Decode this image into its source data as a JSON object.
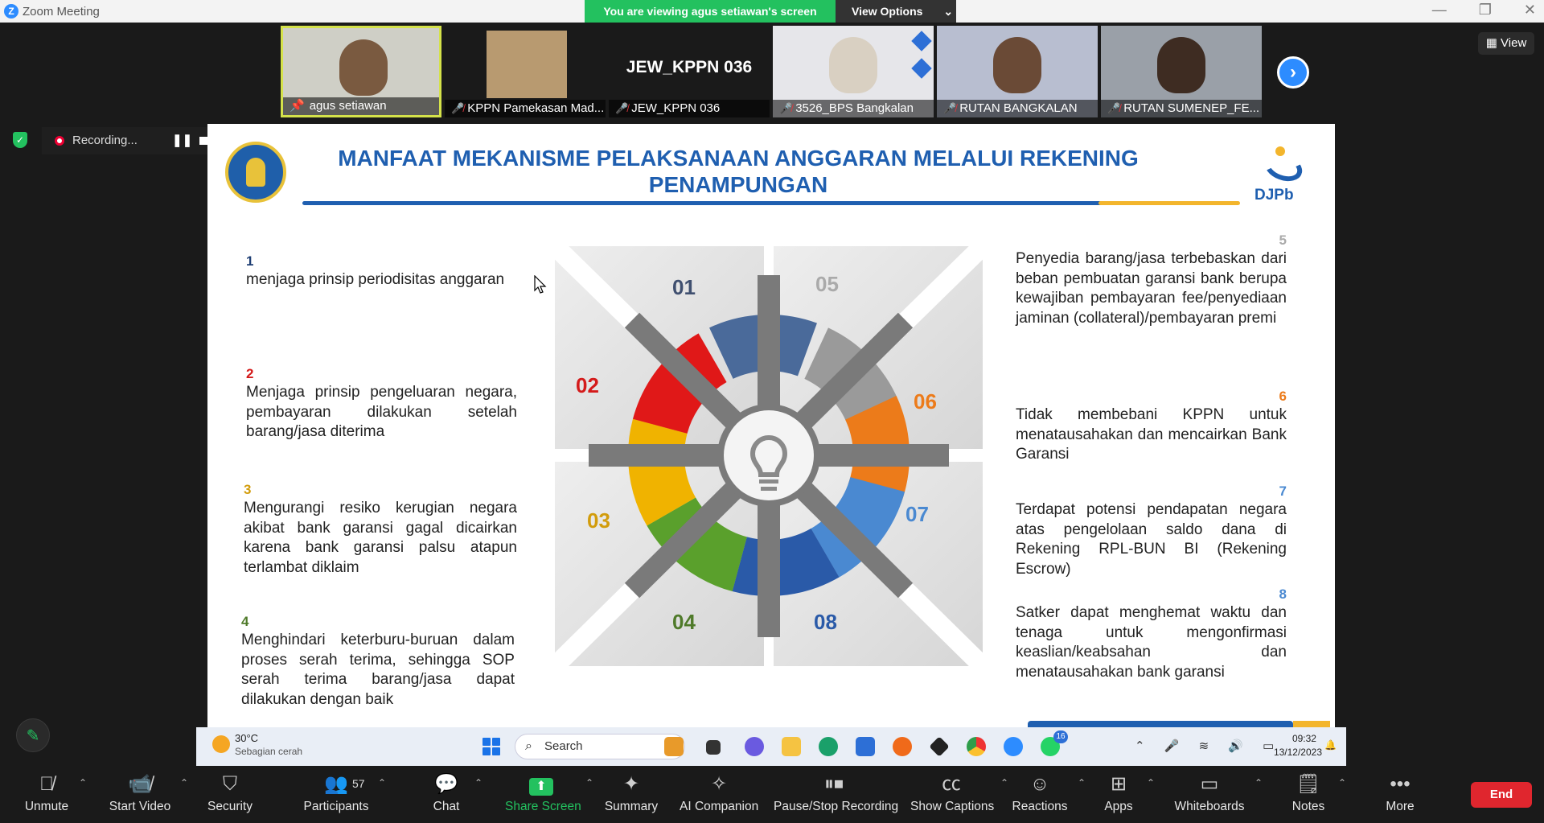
{
  "window": {
    "title": "Zoom Meeting"
  },
  "banner": {
    "viewing": "You are viewing agus setiawan's screen",
    "view_options": "View Options"
  },
  "participants_strip": [
    {
      "name": "agus setiawan",
      "active": true,
      "muted": false
    },
    {
      "name": "KPPN Pamekasan Mad...",
      "muted": true
    },
    {
      "name": "JEW_KPPN 036",
      "muted": true,
      "big_label": "JEW_KPPN 036"
    },
    {
      "name": "3526_BPS Bangkalan",
      "muted": true
    },
    {
      "name": "RUTAN BANGKALAN",
      "muted": true
    },
    {
      "name": "RUTAN SUMENEP_FE...",
      "muted": true
    }
  ],
  "view_button": "View",
  "recording": {
    "label": "Recording..."
  },
  "slide": {
    "title": "MANFAAT MEKANISME PELAKSANAAN ANGGARAN MELALUI REKENING PENAMPUNGAN",
    "logo_right": "DJPb",
    "left_items": [
      {
        "num": "1",
        "text": "menjaga prinsip periodisitas anggaran"
      },
      {
        "num": "2",
        "text": "Menjaga prinsip pengeluaran negara, pembayaran dilakukan setelah barang/jasa diterima"
      },
      {
        "num": "3",
        "text": "Mengurangi resiko kerugian negara akibat bank garansi gagal dicairkan karena bank garansi palsu atapun terlambat diklaim"
      },
      {
        "num": "4",
        "text": "Menghindari keterburu-buruan dalam proses serah terima, sehingga SOP serah terima barang/jasa dapat dilakukan dengan baik"
      }
    ],
    "right_items": [
      {
        "num": "5",
        "text": "Penyedia barang/jasa terbebaskan dari beban pembuatan garansi bank berupa kewajiban pembayaran fee/penyediaan jaminan (collateral)/pembayaran premi"
      },
      {
        "num": "6",
        "text": "Tidak membebani KPPN untuk menatausahakan dan mencairkan Bank Garansi"
      },
      {
        "num": "7",
        "text": "Terdapat potensi pendapatan negara atas pengelolaan saldo dana di Rekening RPL-BUN BI (Rekening Escrow)"
      },
      {
        "num": "8",
        "text": "Satker dapat menghemat waktu dan tenaga untuk mengonfirmasi keaslian/keabsahan dan menatausahakan bank garansi"
      }
    ],
    "graphic_labels": [
      "01",
      "02",
      "03",
      "04",
      "05",
      "06",
      "07",
      "08"
    ],
    "colors": {
      "01": "#3f4f6f",
      "02": "#d41a1a",
      "03": "#d29c0c",
      "04": "#4f7a2a",
      "05": "#aaaaaa",
      "06": "#ec7b1a",
      "07": "#4a89d1",
      "08": "#2a5aa8"
    }
  },
  "taskbar": {
    "weather_temp": "30°C",
    "weather_cond": "Sebagian cerah",
    "search_placeholder": "Search",
    "time": "09:32",
    "date": "13/12/2023",
    "whatsapp_badge": "16"
  },
  "toolbar": {
    "unmute": "Unmute",
    "start_video": "Start Video",
    "security": "Security",
    "participants": "Participants",
    "participants_count": "57",
    "chat": "Chat",
    "share_screen": "Share Screen",
    "summary": "Summary",
    "ai_companion": "AI Companion",
    "pause_stop": "Pause/Stop Recording",
    "show_captions": "Show Captions",
    "reactions": "Reactions",
    "apps": "Apps",
    "whiteboards": "Whiteboards",
    "notes": "Notes",
    "more": "More",
    "end": "End"
  }
}
